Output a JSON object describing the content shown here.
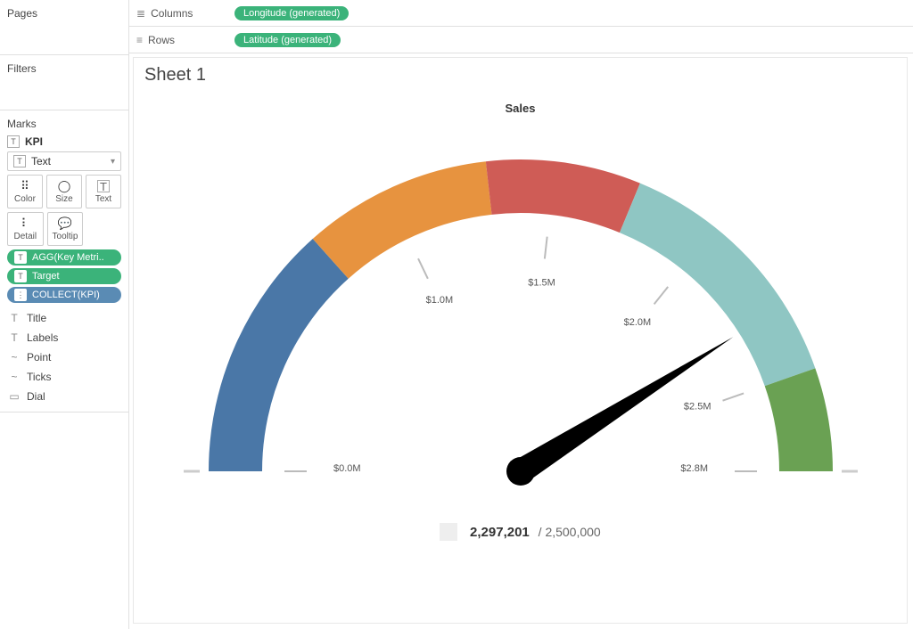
{
  "sidebar": {
    "pages_label": "Pages",
    "filters_label": "Filters",
    "marks_label": "Marks",
    "kpi_label": "KPI",
    "text_dropdown": "Text",
    "buttons": {
      "color": "Color",
      "size": "Size",
      "text": "Text",
      "detail": "Detail",
      "tooltip": "Tooltip"
    },
    "pills": [
      {
        "label": "AGG(Key Metri..",
        "icon": "T",
        "cls": "green"
      },
      {
        "label": "Target",
        "icon": "T",
        "cls": "green"
      },
      {
        "label": "COLLECT(KPI)",
        "icon": "⋮",
        "cls": "blue"
      }
    ],
    "shelves": [
      {
        "icon": "T",
        "label": "Title"
      },
      {
        "icon": "T",
        "label": "Labels"
      },
      {
        "icon": "~",
        "label": "Point"
      },
      {
        "icon": "~",
        "label": "Ticks"
      },
      {
        "icon": "▭",
        "label": "Dial"
      }
    ]
  },
  "top_shelves": {
    "columns_label": "Columns",
    "rows_label": "Rows",
    "columns_pill": "Longitude (generated)",
    "rows_pill": "Latitude (generated)"
  },
  "sheet": {
    "title": "Sheet 1"
  },
  "chart_data": {
    "type": "gauge",
    "title": "Sales",
    "range": [
      0,
      2800000
    ],
    "value": 2297201,
    "target": 2500000,
    "value_display": "2,297,201",
    "target_display": "2,500,000",
    "ticks": [
      {
        "v": 0,
        "label": "$0.0M"
      },
      {
        "v": 1000000,
        "label": "$1.0M"
      },
      {
        "v": 1500000,
        "label": "$1.5M"
      },
      {
        "v": 2000000,
        "label": "$2.0M"
      },
      {
        "v": 2500000,
        "label": "$2.5M"
      },
      {
        "v": 2800000,
        "label": "$2.8M"
      }
    ],
    "segments": [
      {
        "from": 0,
        "to": 750000,
        "color": "#4a77a7"
      },
      {
        "from": 750000,
        "to": 1300000,
        "color": "#e7933f"
      },
      {
        "from": 1300000,
        "to": 1750000,
        "color": "#cf5c56"
      },
      {
        "from": 1750000,
        "to": 2500000,
        "color": "#8fc6c3"
      },
      {
        "from": 2500000,
        "to": 2800000,
        "color": "#6aa153"
      }
    ]
  }
}
